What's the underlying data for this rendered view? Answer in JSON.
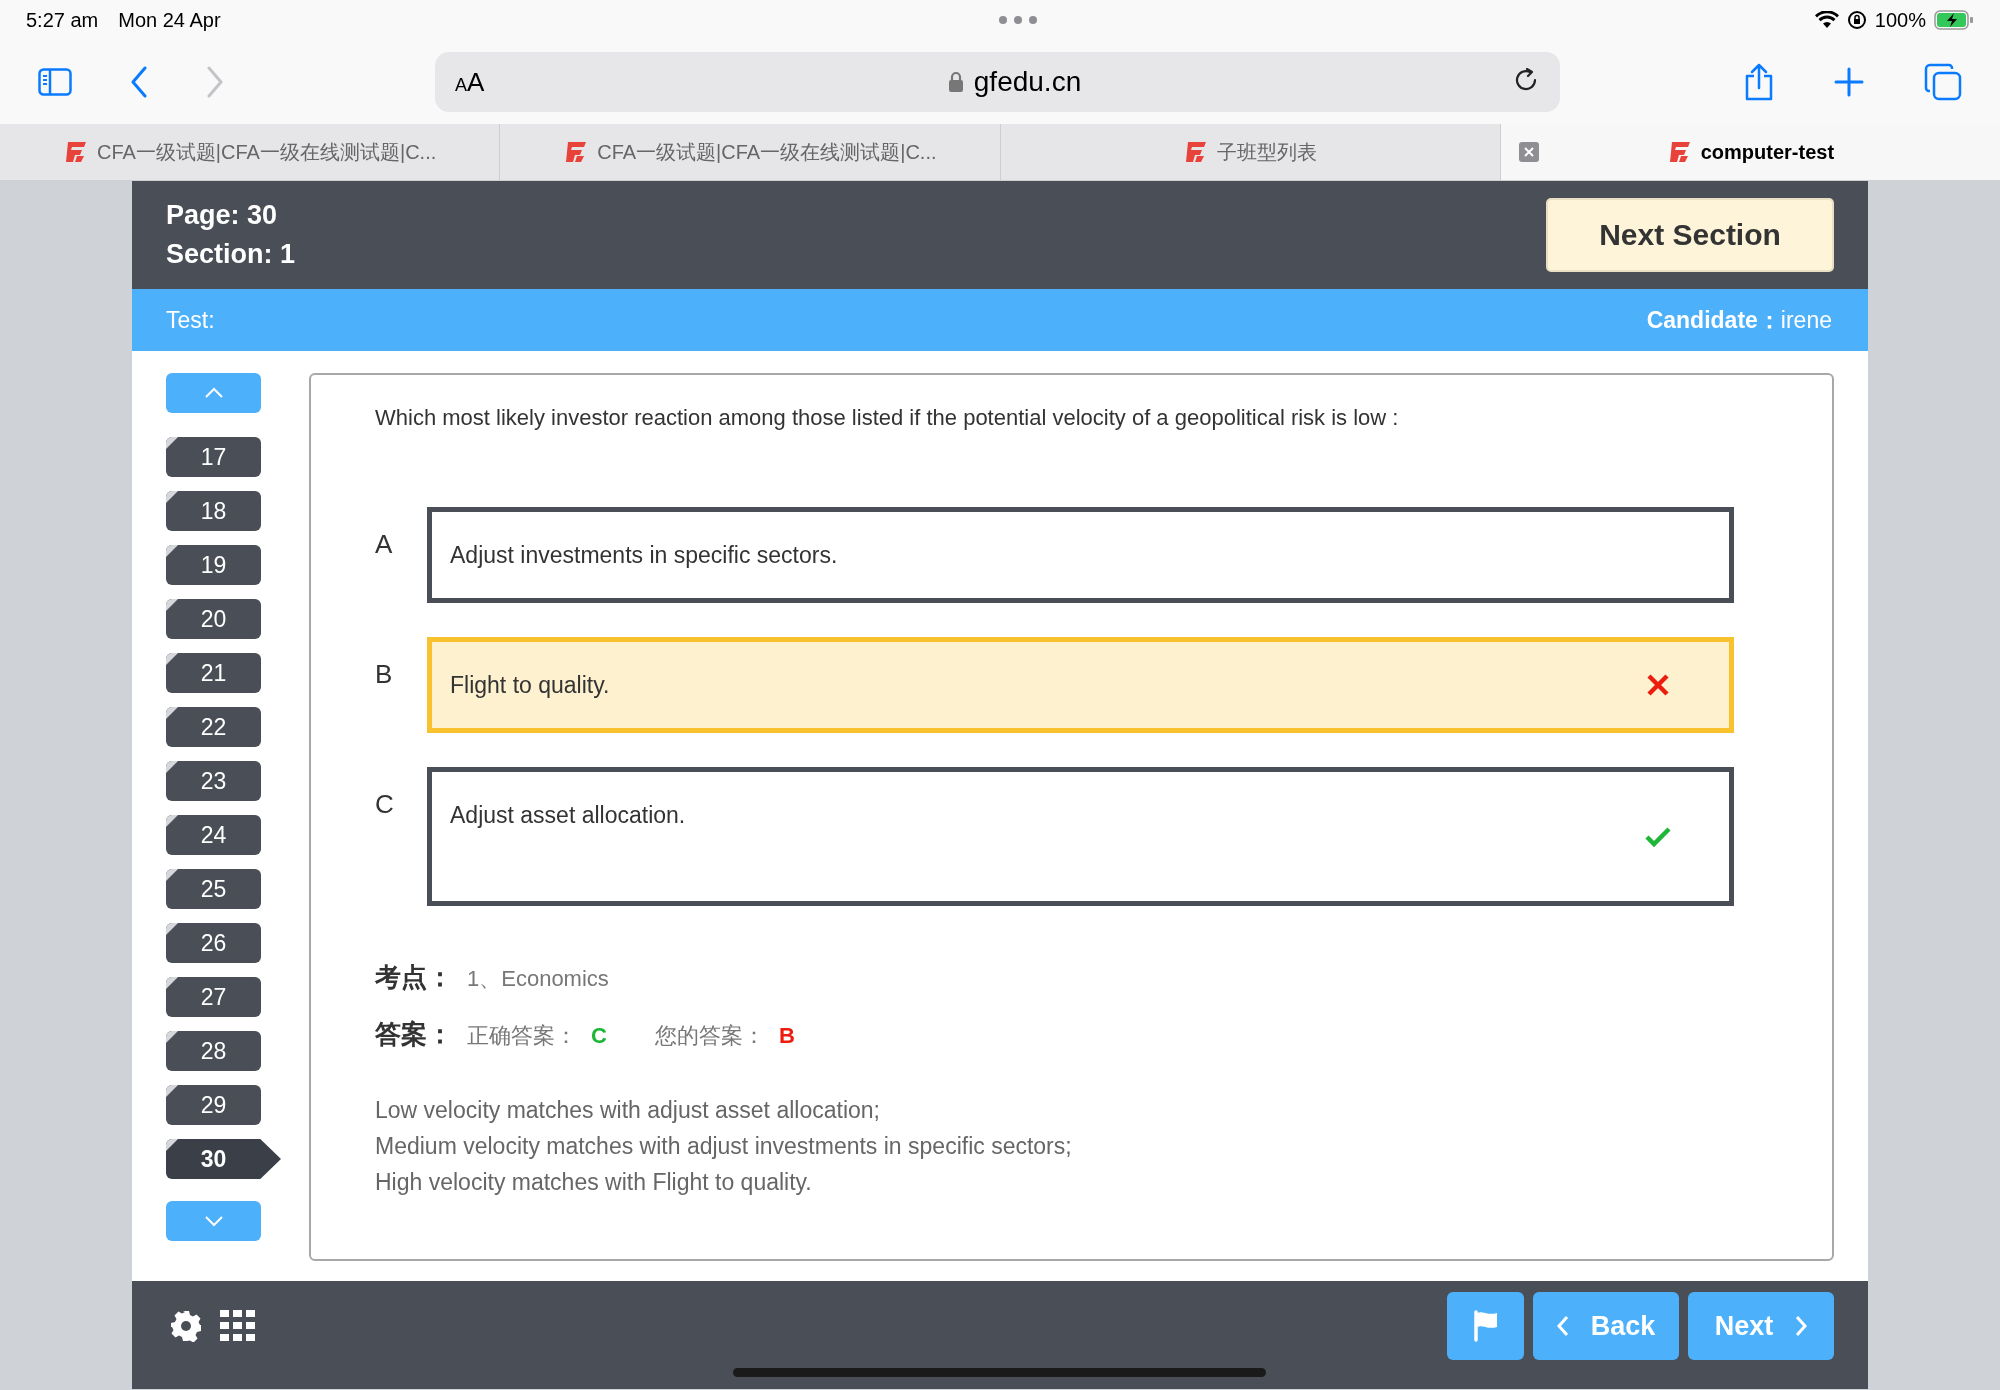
{
  "status_bar": {
    "time": "5:27 am",
    "date": "Mon 24 Apr",
    "battery": "100%"
  },
  "browser": {
    "text_size": "AA",
    "url": "gfedu.cn",
    "tabs": [
      {
        "label": "CFA一级试题|CFA一级在线测试题|C...",
        "selected": false
      },
      {
        "label": "CFA一级试题|CFA一级在线测试题|C...",
        "selected": false
      },
      {
        "label": "子班型列表",
        "selected": false
      },
      {
        "label": "computer-test",
        "selected": true
      }
    ]
  },
  "exam_header": {
    "page": "Page: 30",
    "section": "Section: 1",
    "next_section_button": "Next Section"
  },
  "info_bar": {
    "test_label": "Test:",
    "candidate_label": "Candidate：",
    "candidate_name": "irene"
  },
  "question_nav": {
    "items": [
      {
        "label": "17",
        "selected": false
      },
      {
        "label": "18",
        "selected": false
      },
      {
        "label": "19",
        "selected": false
      },
      {
        "label": "20",
        "selected": false
      },
      {
        "label": "21",
        "selected": false
      },
      {
        "label": "22",
        "selected": false
      },
      {
        "label": "23",
        "selected": false
      },
      {
        "label": "24",
        "selected": false
      },
      {
        "label": "25",
        "selected": false
      },
      {
        "label": "26",
        "selected": false
      },
      {
        "label": "27",
        "selected": false
      },
      {
        "label": "28",
        "selected": false
      },
      {
        "label": "29",
        "selected": false
      },
      {
        "label": "30",
        "selected": true
      }
    ]
  },
  "question": {
    "text": "Which most likely investor reaction among those listed if the potential velocity of a geopolitical risk is low :",
    "options": [
      {
        "letter": "A",
        "text": "Adjust investments in specific sectors.",
        "selected": false,
        "kind": "plain"
      },
      {
        "letter": "B",
        "text": "Flight to quality.",
        "selected": true,
        "kind": "wrong"
      },
      {
        "letter": "C",
        "text": "Adjust asset allocation.",
        "selected": false,
        "kind": "correct"
      }
    ]
  },
  "topic": {
    "label": "考点：",
    "value": "1、Economics"
  },
  "answer": {
    "label": "答案：",
    "correct_label": "正确答案：",
    "correct_value": "C",
    "your_label": "您的答案：",
    "your_value": "B"
  },
  "explanation": [
    "Low velocity matches with adjust asset allocation;",
    "Medium velocity matches with adjust investments in specific sectors;",
    "High velocity matches with Flight to quality."
  ],
  "footer": {
    "back_button": "Back",
    "next_button": "Next"
  }
}
